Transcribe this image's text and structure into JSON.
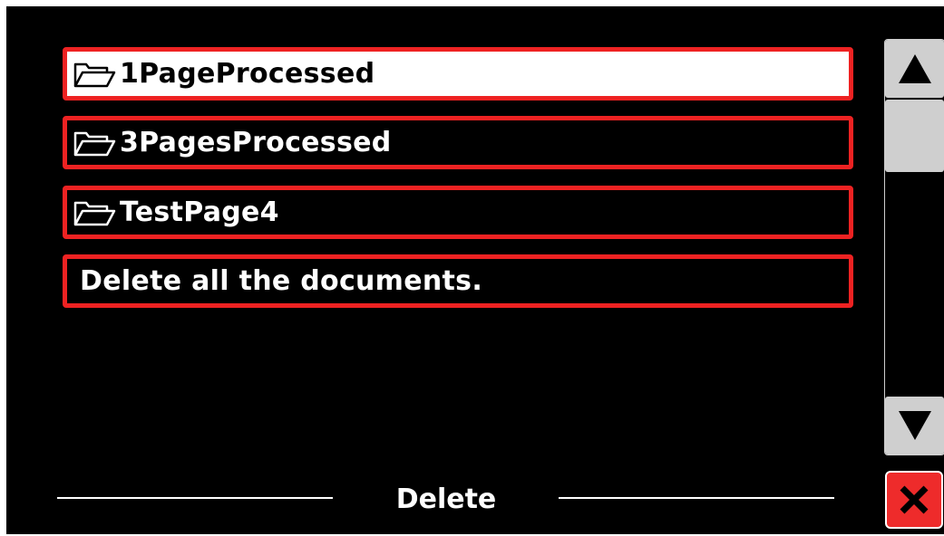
{
  "folders": [
    {
      "name": "1PageProcessed",
      "icon": "folder-icon",
      "selected": true
    },
    {
      "name": "3PagesProcessed",
      "icon": "folder-icon",
      "selected": false
    },
    {
      "name": "TestPage4",
      "icon": "folder-icon",
      "selected": false
    }
  ],
  "delete_all_label": "Delete all the documents.",
  "footer": {
    "title": "Delete"
  },
  "scrollbar": {
    "up_icon": "triangle-up-icon",
    "down_icon": "triangle-down-icon"
  },
  "close_icon": "close-icon",
  "colors": {
    "border": "#ee2222",
    "selected_bg": "#ffffff",
    "background": "#000000",
    "close_bg": "#ee2b2b",
    "scroll": "#cfcfcf"
  }
}
